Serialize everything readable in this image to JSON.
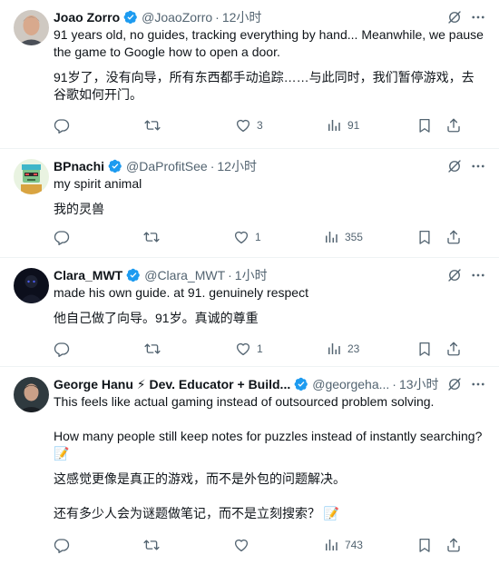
{
  "tweets": [
    {
      "name": "Joao Zorro",
      "handle": "@JoaoZorro",
      "time": "12小时",
      "text_en": "91 years old, no guides, tracking everything by hand... Meanwhile, we pause the game to Google how to open a door.",
      "text_zh": "91岁了，没有向导，所有东西都手动追踪……与此同时，我们暂停游戏，去谷歌如何开门。",
      "replies": "",
      "retweets": "",
      "likes": "3",
      "views": "91"
    },
    {
      "name": "BPnachi",
      "handle": "@DaProfitSee",
      "time": "12小时",
      "text_en": "my spirit animal",
      "text_zh": "我的灵兽",
      "replies": "",
      "retweets": "",
      "likes": "1",
      "views": "355"
    },
    {
      "name": "Clara_MWT",
      "handle": "@Clara_MWT",
      "time": "1小时",
      "text_en": "made his own guide. at 91. genuinely respect",
      "text_zh": "他自己做了向导。91岁。真诚的尊重",
      "replies": "",
      "retweets": "",
      "likes": "1",
      "views": "23"
    },
    {
      "name": "George Hanu ⚡ Dev. Educator + Build...",
      "handle": "@georgeha...",
      "time": "13小时",
      "text_en": "This feels like actual gaming instead of outsourced problem solving.\n\nHow many people still keep notes for puzzles instead of instantly searching? 📝",
      "text_zh": "这感觉更像是真正的游戏，而不是外包的问题解决。\n\n还有多少人会为谜题做笔记，而不是立刻搜索？ 📝",
      "replies": "",
      "retweets": "",
      "likes": "",
      "views": "743"
    }
  ],
  "colors": {
    "verified": "#1d9bf0",
    "muted": "#536471",
    "text": "#0f1419",
    "divider": "#eff3f4"
  },
  "icons": [
    "verified-badge-icon",
    "grok-icon",
    "more-icon",
    "reply-icon",
    "retweet-icon",
    "like-icon",
    "views-icon",
    "bookmark-icon",
    "share-icon"
  ]
}
